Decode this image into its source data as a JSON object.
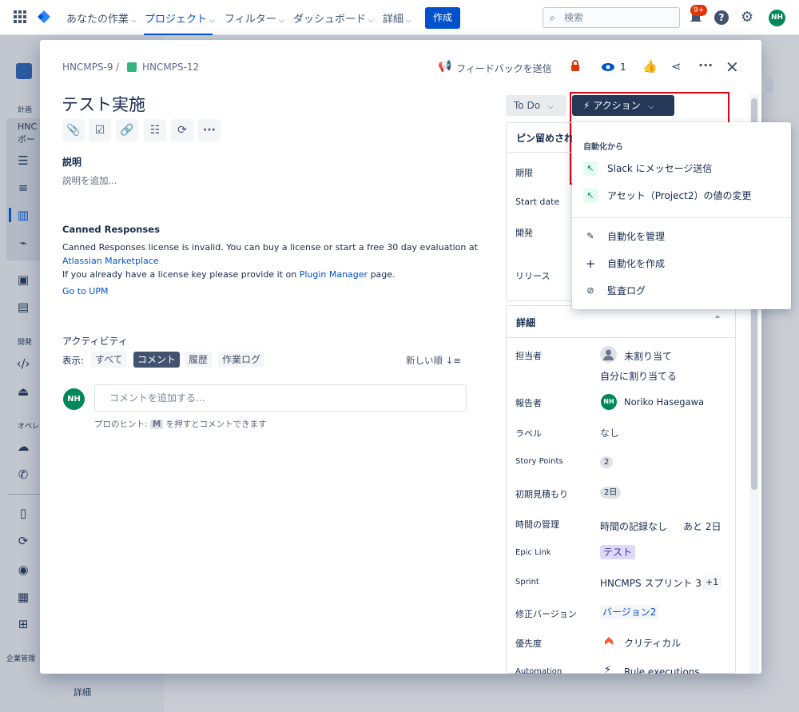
{
  "topnav": {
    "items": [
      "あなたの作業",
      "プロジェクト",
      "フィルター",
      "ダッシュボード",
      "詳細"
    ],
    "create": "作成",
    "search_placeholder": "検索",
    "notif_badge": "9+",
    "avatar": "NH"
  },
  "sidebar": {
    "labels": [
      "計画",
      "HNC",
      "ボー",
      "開発",
      "オペレ",
      "企業管理"
    ],
    "bottom_item": "詳細"
  },
  "issue": {
    "breadcrumb_parent": "HNCMPS-9",
    "breadcrumb_sep": "/",
    "breadcrumb_key": "HNCMPS-12",
    "feedback": "フィードバックを送信",
    "watch_count": "1",
    "title": "テスト実施",
    "description_label": "説明",
    "description_placeholder": "説明を追加...",
    "canned_title": "Canned Responses",
    "canned_line1": "Canned Responses license is invalid. You can buy a license or start a free 30 day evaluation at",
    "canned_link1": "Atlassian Marketplace",
    "canned_line2_a": "If you already have a license key please provide it on",
    "canned_link2": "Plugin Manager",
    "canned_line2_b": "page.",
    "canned_link3": "Go to UPM",
    "activity_label": "アクティビティ",
    "show_label": "表示:",
    "activity_tabs": [
      "すべて",
      "コメント",
      "履歴",
      "作業ログ"
    ],
    "sort_label": "新しい順",
    "comment_avatar": "NH",
    "comment_placeholder": "コメントを追加する...",
    "tip_prefix": "プロのヒント:",
    "tip_key": "M",
    "tip_suffix": "を押すとコメントできます"
  },
  "panel": {
    "status": "To Do",
    "action": "アクション",
    "pinned": "ピン留めされ",
    "pinned_fields": [
      "期限",
      "Start date",
      "開発",
      "リリース"
    ],
    "details": "詳細",
    "fields": [
      {
        "label": "担当者",
        "value": "未割り当て",
        "extra": "自分に割り当てる"
      },
      {
        "label": "報告者",
        "value": "Noriko Hasegawa",
        "avatar": "NH"
      },
      {
        "label": "ラベル",
        "value": "なし"
      },
      {
        "label": "Story Points",
        "value": "2"
      },
      {
        "label": "初期見積もり",
        "value": "2日"
      },
      {
        "label": "時間の管理",
        "value": "時間の記録なし",
        "extra": "あと 2日"
      },
      {
        "label": "Epic Link",
        "value": "テスト"
      },
      {
        "label": "Sprint",
        "value": "HNCMPS スプリント 3",
        "extra": "+1"
      },
      {
        "label": "修正バージョン",
        "value": "バージョン2"
      },
      {
        "label": "優先度",
        "value": "クリティカル"
      },
      {
        "label": "Automation",
        "value": "Rule executions"
      }
    ]
  },
  "dropdown": {
    "heading": "自動化から",
    "rules": [
      "Slack にメッセージ送信",
      "アセット（Project2）の値の変更"
    ],
    "manage": "自動化を管理",
    "create": "自動化を作成",
    "audit": "監査ログ"
  },
  "colors": {
    "brand": "#0052cc",
    "highlight": "#e60012",
    "action_bg": "#253858",
    "epic": "#dfd8fd"
  }
}
